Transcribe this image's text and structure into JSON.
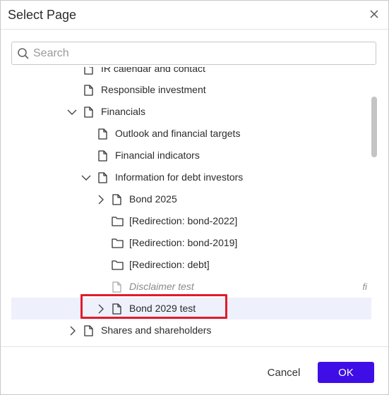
{
  "dialog": {
    "title": "Select Page",
    "close_icon": "close-icon"
  },
  "search": {
    "placeholder": "Search",
    "value": ""
  },
  "tree": {
    "items": [
      {
        "label": "IR calendar and contact",
        "icon": "page-icon",
        "toggle": "none"
      },
      {
        "label": "Responsible investment",
        "icon": "page-icon",
        "toggle": "none"
      },
      {
        "label": "Financials",
        "icon": "page-icon",
        "toggle": "expanded"
      },
      {
        "label": "Outlook and financial targets",
        "icon": "page-icon",
        "toggle": "none"
      },
      {
        "label": "Financial indicators",
        "icon": "page-icon",
        "toggle": "none"
      },
      {
        "label": "Information for debt investors",
        "icon": "page-icon",
        "toggle": "expanded"
      },
      {
        "label": "Bond 2025",
        "icon": "page-icon",
        "toggle": "collapsed"
      },
      {
        "label": "[Redirection: bond-2022]",
        "icon": "folder-icon",
        "toggle": "none"
      },
      {
        "label": "[Redirection: bond-2019]",
        "icon": "folder-icon",
        "toggle": "none"
      },
      {
        "label": "[Redirection: debt]",
        "icon": "folder-icon",
        "toggle": "none"
      },
      {
        "label": "Disclaimer test",
        "icon": "page-icon",
        "toggle": "none",
        "lang": "fi",
        "muted": true
      },
      {
        "label": "Bond 2029 test",
        "icon": "page-icon",
        "toggle": "collapsed",
        "selected": true
      },
      {
        "label": "Shares and shareholders",
        "icon": "page-icon",
        "toggle": "collapsed"
      }
    ]
  },
  "footer": {
    "cancel_label": "Cancel",
    "ok_label": "OK"
  },
  "colors": {
    "accent": "#3f0ee6",
    "highlight": "#e21b2c",
    "selected_row": "#eef1fb"
  }
}
